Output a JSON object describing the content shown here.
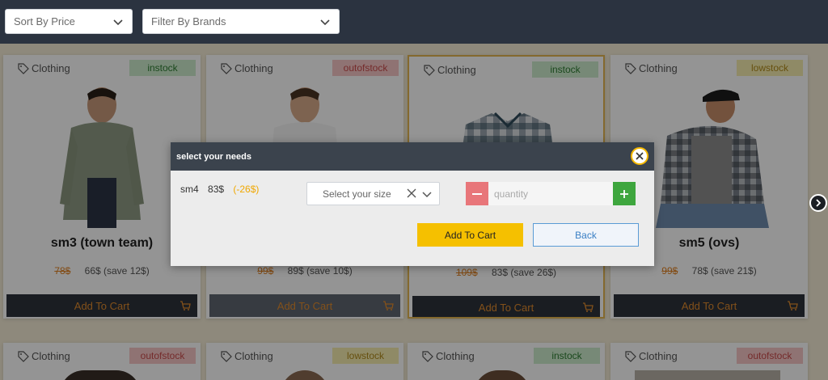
{
  "filters": {
    "sort_label": "Sort By Price",
    "brand_label": "Filter By Brands"
  },
  "products": [
    {
      "category": "Clothing",
      "status": "instock",
      "name": "sm3 (town team)",
      "old_price": "78$",
      "new_price": "66$ (save 12$)",
      "cart_label": "Add To Cart"
    },
    {
      "category": "Clothing",
      "status": "outofstock",
      "name": "",
      "old_price": "99$",
      "new_price": "89$ (save 10$)",
      "cart_label": "Add To Cart"
    },
    {
      "category": "Clothing",
      "status": "instock",
      "name": "",
      "old_price": "109$",
      "new_price": "83$ (save 26$)",
      "cart_label": "Add To Cart"
    },
    {
      "category": "Clothing",
      "status": "lowstock",
      "name": "sm5 (ovs)",
      "old_price": "99$",
      "new_price": "78$ (save 21$)",
      "cart_label": "Add To Cart"
    },
    {
      "category": "Clothing",
      "status": "outofstock"
    },
    {
      "category": "Clothing",
      "status": "lowstock"
    },
    {
      "category": "Clothing",
      "status": "instock"
    },
    {
      "category": "Clothing",
      "status": "outofstock"
    }
  ],
  "modal": {
    "title": "select your needs",
    "product_code": "sm4",
    "price": "83$",
    "discount": "(-26$)",
    "size_placeholder": "Select your size",
    "quantity_placeholder": "quantity",
    "add_to_cart": "Add To Cart",
    "back": "Back"
  },
  "colors": {
    "topbar": "#2b3340",
    "accent_yellow": "#f5c000",
    "minus_red": "#e8767a",
    "plus_green": "#3ea63e"
  }
}
